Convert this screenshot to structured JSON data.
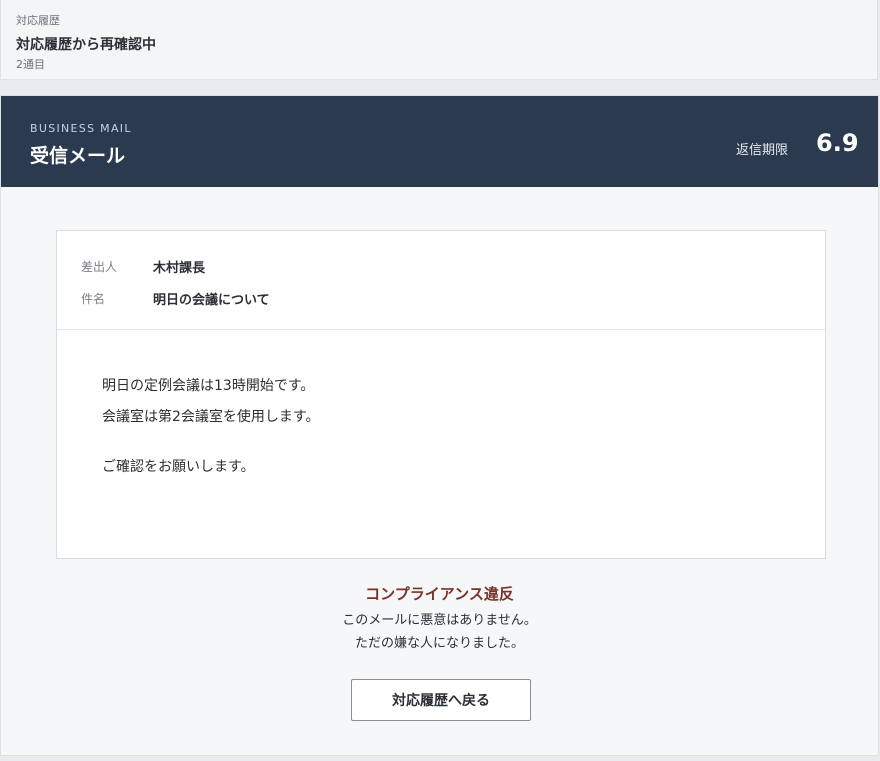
{
  "history": {
    "label": "対応履歴",
    "title": "対応履歴から再確認中",
    "sub": "2通目"
  },
  "mail_panel": {
    "kicker": "BUSINESS MAIL",
    "title": "受信メール",
    "deadline_label": "返信期限",
    "deadline_value": "6.9"
  },
  "mail": {
    "sender_label": "差出人",
    "sender": "木村課長",
    "subject_label": "件名",
    "subject": "明日の会議について",
    "body": [
      "明日の定例会議は13時開始です。",
      "会議室は第2会議室を使用します。",
      "ご確認をお願いします。"
    ]
  },
  "result": {
    "title": "コンプライアンス違反",
    "lines": [
      "このメールに悪意はありません。",
      "ただの嫌な人になりました。"
    ]
  },
  "back_button_label": "対応履歴へ戻る",
  "colors": {
    "header_bg": "#2b3a4f",
    "violation_text": "#7a3228"
  }
}
